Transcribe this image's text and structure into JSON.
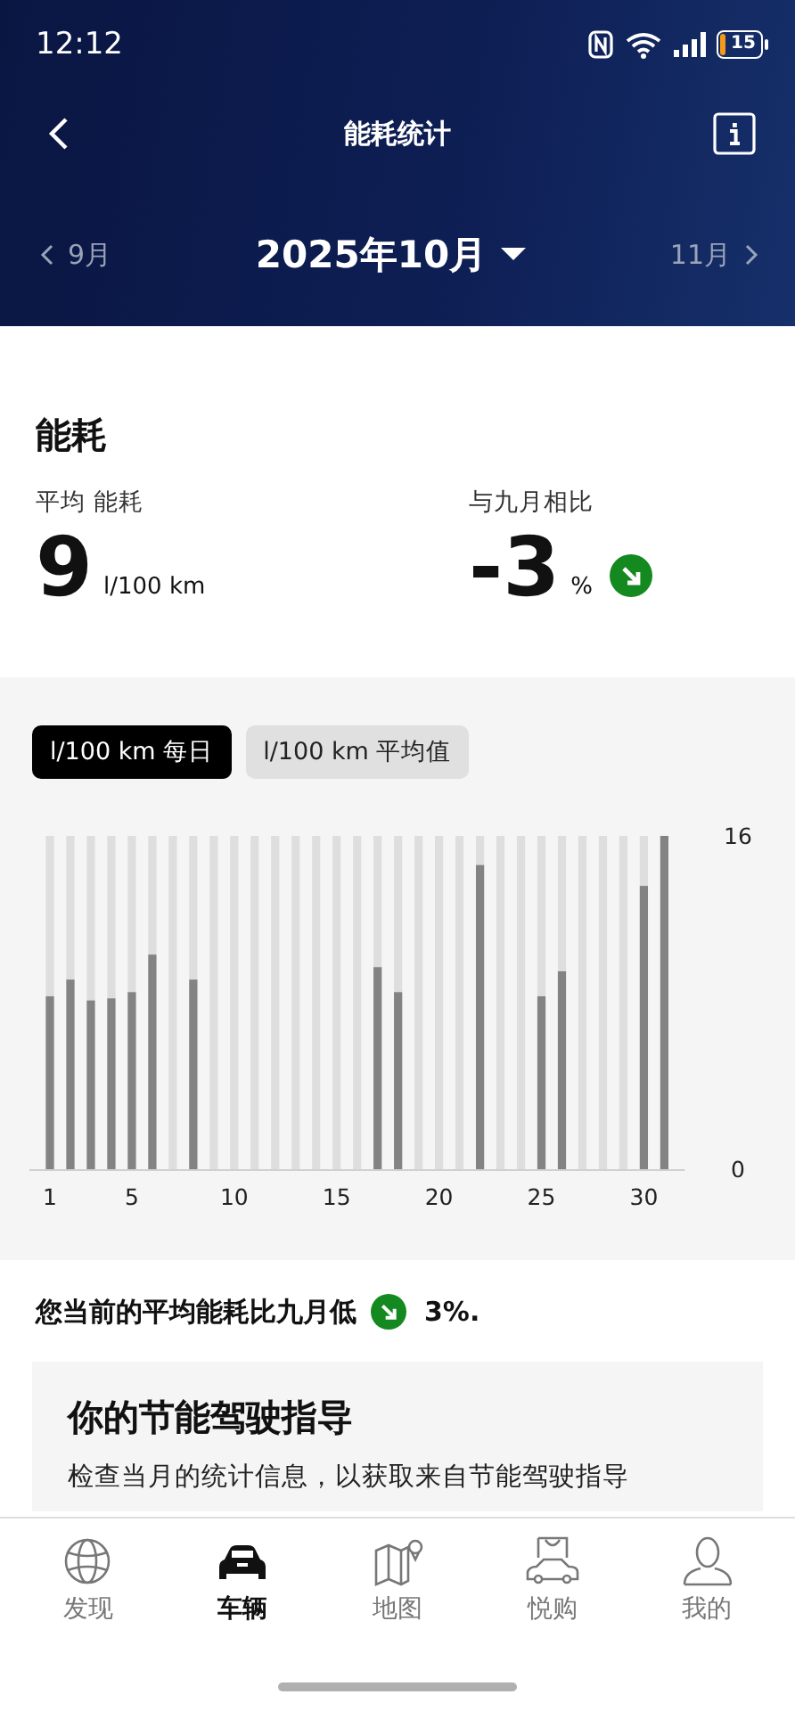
{
  "status_bar": {
    "time": "12:12",
    "battery": "15"
  },
  "header": {
    "title": "能耗统计",
    "prev_month": "9月",
    "current_month": "2025年10月",
    "next_month": "11月"
  },
  "summary": {
    "heading": "能耗",
    "average": {
      "label": "平均 能耗",
      "value": "9",
      "unit": "l/100 km"
    },
    "comparison": {
      "label": "与九月相比",
      "value": "-3",
      "unit": "%",
      "decrease": true
    }
  },
  "chart_section": {
    "tabs": [
      {
        "label": "l/100 km 每日",
        "selected": true
      },
      {
        "label": "l/100 km 平均值",
        "selected": false
      }
    ],
    "chart_data": {
      "type": "bar",
      "x": [
        1,
        2,
        3,
        4,
        5,
        6,
        7,
        8,
        9,
        10,
        11,
        12,
        13,
        14,
        15,
        16,
        17,
        18,
        19,
        20,
        21,
        22,
        23,
        24,
        25,
        26,
        27,
        28,
        29,
        30,
        31
      ],
      "series": [
        {
          "color": "#838383",
          "values": [
            8.3,
            9.1,
            8.1,
            8.2,
            8.5,
            10.3,
            null,
            9.1,
            null,
            null,
            null,
            null,
            null,
            null,
            null,
            null,
            9.7,
            8.5,
            null,
            null,
            null,
            14.6,
            null,
            null,
            8.3,
            9.5,
            null,
            null,
            null,
            13.6,
            16
          ]
        }
      ],
      "grid": true,
      "xlim": [
        0,
        32
      ],
      "ylim": [
        0,
        16
      ],
      "yticks": [
        0,
        16
      ],
      "xticks": [
        1,
        5,
        10,
        15,
        20,
        25,
        30
      ]
    }
  },
  "message": {
    "text": "您当前的平均能耗比九月低",
    "decrease": true,
    "value": "3%."
  },
  "tip_card": {
    "title": "你的节能驾驶指导",
    "text": "检查当月的统计信息，以获取来自节能驾驶指导"
  },
  "nav": {
    "items": [
      {
        "label": "发现",
        "kind": "globe",
        "selected": false
      },
      {
        "label": "车辆",
        "kind": "car",
        "selected": true
      },
      {
        "label": "地图",
        "kind": "map",
        "selected": false
      },
      {
        "label": "悦购",
        "kind": "shop",
        "selected": false
      },
      {
        "label": "我的",
        "kind": "user",
        "selected": false
      }
    ]
  }
}
